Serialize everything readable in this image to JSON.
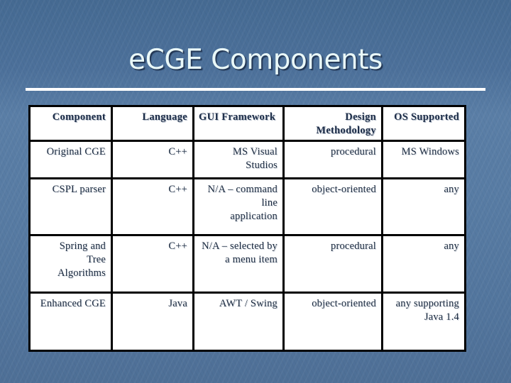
{
  "slide": {
    "title": "eCGE Components",
    "colors": {
      "background": "#52759d",
      "title_text": "#e9f8f8",
      "divider": "#ffffff",
      "table_border": "#000000",
      "table_text": "#1c2b40",
      "table_background": "#ffffff"
    }
  },
  "table": {
    "headers": [
      "Component",
      "Language",
      "GUI Framework",
      "Design\nMethodology",
      "OS Supported"
    ],
    "rows": [
      {
        "component": "Original CGE",
        "language": "C++",
        "gui_framework": "MS Visual\nStudios",
        "design_methodology": "procedural",
        "os_supported": "MS Windows"
      },
      {
        "component": "CSPL parser",
        "language": "C++",
        "gui_framework": "N/A – command\nline\napplication",
        "design_methodology": "object-oriented",
        "os_supported": "any"
      },
      {
        "component": "Spring and\nTree\nAlgorithms",
        "language": "C++",
        "gui_framework": "N/A – selected by\na menu item",
        "design_methodology": "procedural",
        "os_supported": "any"
      },
      {
        "component": "Enhanced CGE",
        "language": "Java",
        "gui_framework": "AWT / Swing",
        "design_methodology": "object-oriented",
        "os_supported": "any supporting\nJava 1.4"
      }
    ]
  }
}
